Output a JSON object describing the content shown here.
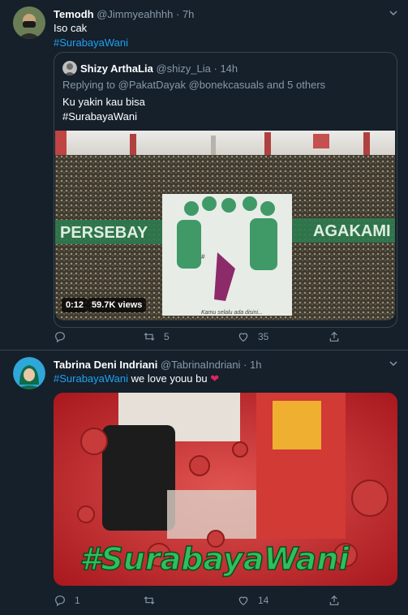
{
  "colors": {
    "background": "#15202b",
    "border": "#38444d",
    "muted": "#8899a6",
    "accent": "#1da1f2",
    "heart": "#e0245e"
  },
  "tweet1": {
    "name": "Temodh",
    "handle": "@Jimmyeahhhh",
    "sep": "·",
    "time": "7h",
    "line1": "Iso cak",
    "hashtag": "#SurabayaWani",
    "quote": {
      "name": "Shizy ArthaLia",
      "handle": "@shizy_Lia",
      "sep": "·",
      "time": "14h",
      "replying_prefix": "Replying to",
      "replying_to": "@PakatDayak @bonekcasuals and 5 others",
      "text_line1": "Ku yakin kau bisa",
      "hashtag": "#SurabayaWani",
      "video_time": "0:12",
      "video_views": "59.7K views",
      "banner_left": "PERSEBAY",
      "banner_right": "AGAKAMI",
      "mural_caption": "Kamu selalu ada disini..."
    },
    "actions": {
      "reply_icon": "reply-icon",
      "retweet_icon": "retweet-icon",
      "retweet_count": "5",
      "like_icon": "heart-icon",
      "like_count": "35",
      "share_icon": "share-icon"
    }
  },
  "tweet2": {
    "name": "Tabrina Deni Indriani",
    "handle": "@TabrinaIndriani",
    "sep": "·",
    "time": "1h",
    "hashtag": "#SurabayaWani",
    "text": "we love youu bu",
    "emoji": "❤",
    "image_text": "#SurabayaWani",
    "actions": {
      "reply_icon": "reply-icon",
      "reply_count": "1",
      "retweet_icon": "retweet-icon",
      "like_icon": "heart-icon",
      "like_count": "14",
      "share_icon": "share-icon"
    }
  }
}
